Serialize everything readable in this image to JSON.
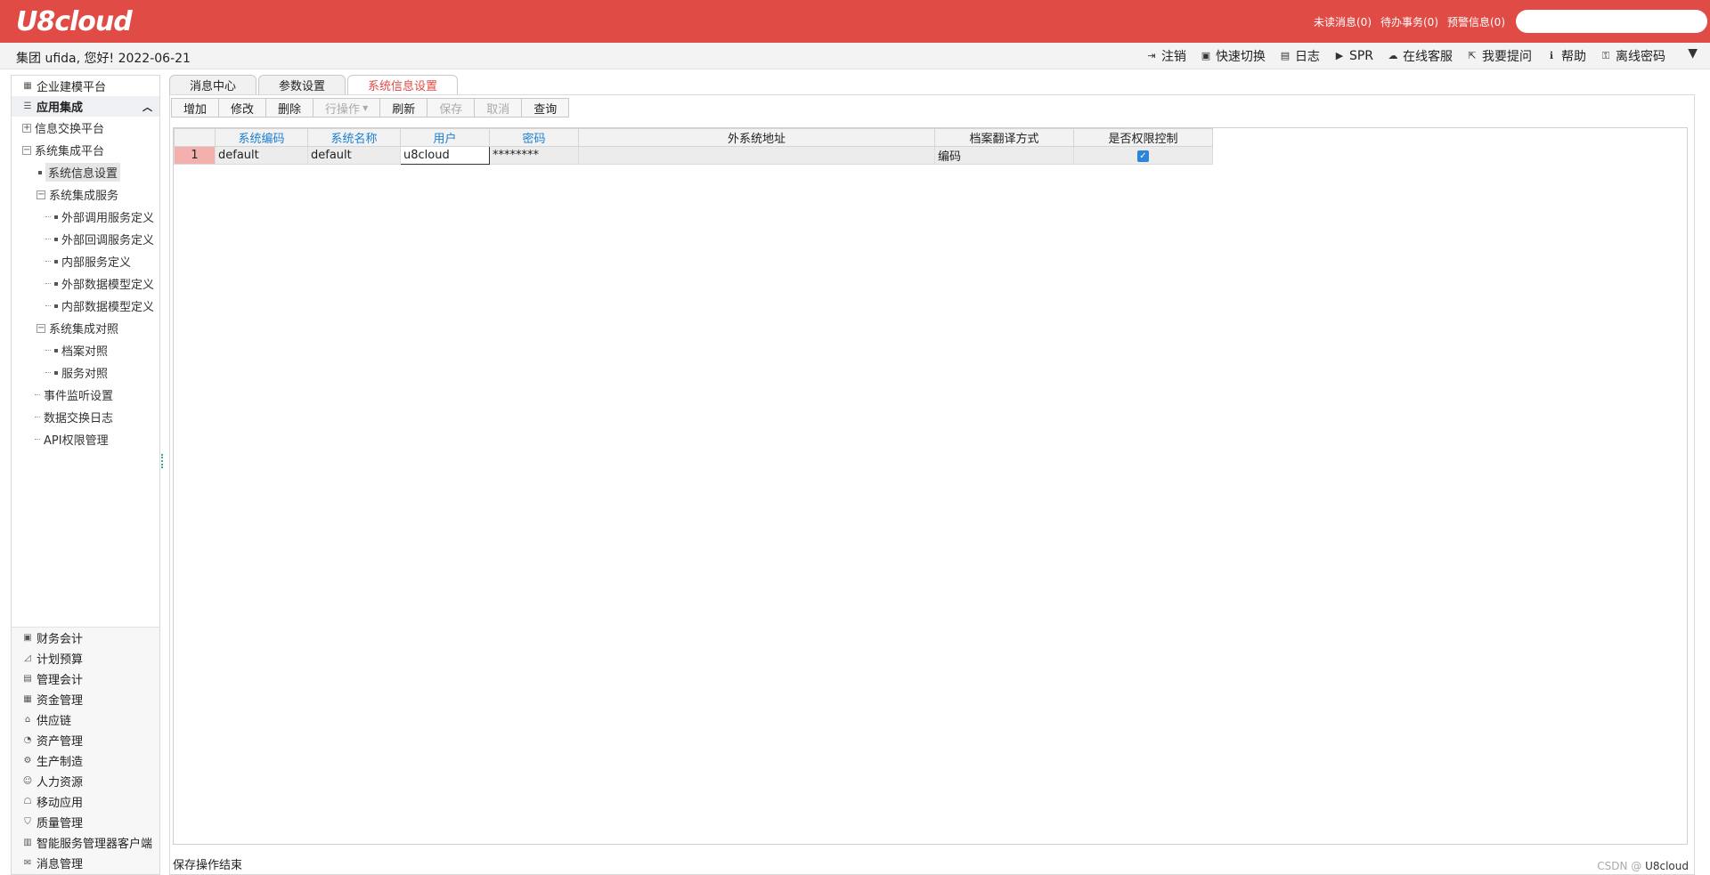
{
  "header": {
    "logo": "U8cloud",
    "links": [
      "未读消息(0)",
      "待办事务(0)",
      "预警信息(0)"
    ],
    "search_placeholder": ""
  },
  "userbar": {
    "greeting": "集团 ufida, 您好! 2022-06-21",
    "actions": [
      {
        "label": "注销",
        "icon": "logout-icon"
      },
      {
        "label": "快速切换",
        "icon": "switch-icon"
      },
      {
        "label": "日志",
        "icon": "log-icon"
      },
      {
        "label": "SPR",
        "icon": "play-icon"
      },
      {
        "label": "在线客服",
        "icon": "service-icon"
      },
      {
        "label": "我要提问",
        "icon": "question-icon"
      },
      {
        "label": "帮助",
        "icon": "help-icon"
      },
      {
        "label": "离线密码",
        "icon": "key-icon"
      }
    ]
  },
  "sidebar": {
    "platform": "企业建模平台",
    "section": "应用集成",
    "tree": [
      {
        "label": "信息交换平台"
      },
      {
        "label": "系统集成平台"
      },
      {
        "label": "系统信息设置"
      },
      {
        "label": "系统集成服务"
      },
      {
        "label": "外部调用服务定义"
      },
      {
        "label": "外部回调服务定义"
      },
      {
        "label": "内部服务定义"
      },
      {
        "label": "外部数据模型定义"
      },
      {
        "label": "内部数据模型定义"
      },
      {
        "label": "系统集成对照"
      },
      {
        "label": "档案对照"
      },
      {
        "label": "服务对照"
      },
      {
        "label": "事件监听设置"
      },
      {
        "label": "数据交换日志"
      },
      {
        "label": "API权限管理"
      }
    ],
    "modules": [
      {
        "label": "财务会计",
        "icon": "finance-icon"
      },
      {
        "label": "计划预算",
        "icon": "budget-icon"
      },
      {
        "label": "管理会计",
        "icon": "management-accounting-icon"
      },
      {
        "label": "资金管理",
        "icon": "fund-icon"
      },
      {
        "label": "供应链",
        "icon": "supply-chain-icon"
      },
      {
        "label": "资产管理",
        "icon": "asset-icon"
      },
      {
        "label": "生产制造",
        "icon": "manufacturing-icon"
      },
      {
        "label": "人力资源",
        "icon": "hr-icon"
      },
      {
        "label": "移动应用",
        "icon": "mobile-icon"
      },
      {
        "label": "质量管理",
        "icon": "quality-icon"
      },
      {
        "label": "智能服务管理器客户端",
        "icon": "smart-service-icon"
      },
      {
        "label": "消息管理",
        "icon": "message-icon"
      }
    ]
  },
  "tabs": [
    "消息中心",
    "参数设置",
    "系统信息设置"
  ],
  "toolbar": {
    "add": "增加",
    "edit": "修改",
    "delete": "删除",
    "row_ops": "行操作",
    "refresh": "刷新",
    "save": "保存",
    "cancel": "取消",
    "query": "查询"
  },
  "grid": {
    "columns": [
      "系统编码",
      "系统名称",
      "用户",
      "密码",
      "外系统地址",
      "档案翻译方式",
      "是否权限控制"
    ],
    "rows": [
      {
        "num": "1",
        "code": "default",
        "name": "default",
        "user": "u8cloud",
        "password": "********",
        "address": "",
        "translate": "编码",
        "permission": true
      }
    ]
  },
  "status": {
    "message": "保存操作结束",
    "right": "U8cloud",
    "watermark": "CSDN @"
  }
}
